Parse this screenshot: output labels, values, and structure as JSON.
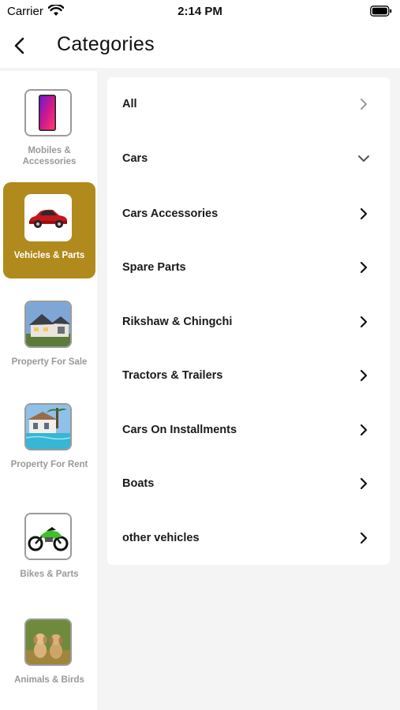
{
  "status_bar": {
    "carrier": "Carrier",
    "time": "2:14 PM"
  },
  "header": {
    "title": "Categories"
  },
  "sidebar": {
    "items": [
      {
        "label": "Mobiles & Accessories",
        "active": false,
        "image": "phone-image"
      },
      {
        "label": "Vehicles & Parts",
        "active": true,
        "image": "car-image"
      },
      {
        "label": "Property For Sale",
        "active": false,
        "image": "house-image"
      },
      {
        "label": "Property For Rent",
        "active": false,
        "image": "villa-pool-image"
      },
      {
        "label": "Bikes & Parts",
        "active": false,
        "image": "motorbike-image"
      },
      {
        "label": "Animals & Birds",
        "active": false,
        "image": "puppies-image"
      }
    ]
  },
  "subcategories": {
    "rows": [
      {
        "label": "All",
        "chevron": "right-light"
      },
      {
        "label": "Cars",
        "chevron": "down"
      },
      {
        "label": "Cars Accessories",
        "chevron": "right"
      },
      {
        "label": "Spare Parts",
        "chevron": "right"
      },
      {
        "label": "Rikshaw & Chingchi",
        "chevron": "right"
      },
      {
        "label": "Tractors & Trailers",
        "chevron": "right"
      },
      {
        "label": "Cars On Installments",
        "chevron": "right"
      },
      {
        "label": "Boats",
        "chevron": "right"
      },
      {
        "label": "other vehicles",
        "chevron": "right"
      }
    ]
  },
  "colors": {
    "accent": "#b18a1d",
    "background": "#f4f4f4"
  }
}
